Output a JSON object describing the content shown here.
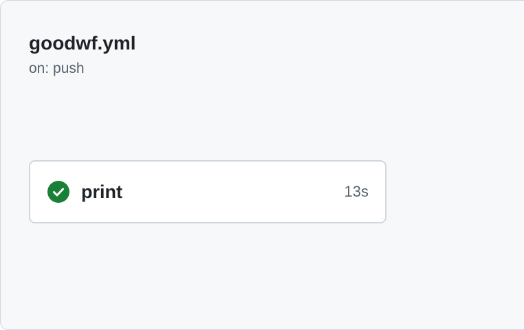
{
  "workflow": {
    "title": "goodwf.yml",
    "trigger": "on: push"
  },
  "jobs": [
    {
      "name": "print",
      "duration": "13s",
      "status": "success",
      "status_icon": "check-circle-fill-icon",
      "status_color": "#1a7f37"
    }
  ],
  "colors": {
    "panel_background": "#f6f8fa",
    "border": "#d0d7de",
    "text_primary": "#1f2328",
    "text_muted": "#59636e",
    "success": "#1a7f37"
  }
}
